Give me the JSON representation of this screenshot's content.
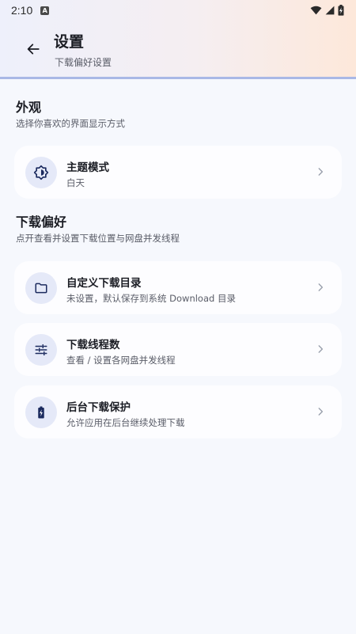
{
  "status_bar": {
    "time": "2:10",
    "notification_glyph": "A"
  },
  "header": {
    "title": "设置",
    "subtitle": "下载偏好设置"
  },
  "sections": {
    "appearance": {
      "title": "外观",
      "description": "选择你喜欢的界面显示方式",
      "items": [
        {
          "title": "主题模式",
          "subtitle": "白天",
          "icon": "brightness-auto-icon"
        }
      ]
    },
    "download": {
      "title": "下载偏好",
      "description": "点开查看并设置下载位置与网盘并发线程",
      "items": [
        {
          "title": "自定义下载目录",
          "subtitle": "未设置，默认保存到系统 Download 目录",
          "icon": "folder-icon"
        },
        {
          "title": "下载线程数",
          "subtitle": "查看 / 设置各网盘并发线程",
          "icon": "tune-sliders-icon"
        },
        {
          "title": "后台下载保护",
          "subtitle": "允许应用在后台继续处理下载",
          "icon": "battery-charging-icon"
        }
      ]
    }
  },
  "colors": {
    "accent": "#1b2a5e",
    "icon_bg": "#e5e9f8",
    "card_bg": "#fdfdff",
    "page_bg": "#f6f8fd",
    "header_border": "#a9b8e6"
  }
}
